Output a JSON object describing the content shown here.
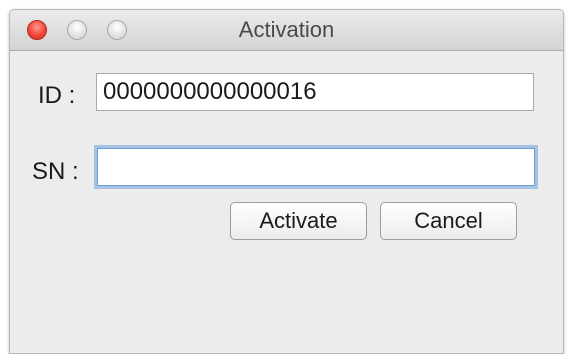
{
  "window": {
    "title": "Activation",
    "controls": {
      "close_icon": "close-traffic-light",
      "minimize_icon": "minimize-traffic-light",
      "zoom_icon": "zoom-traffic-light",
      "close_color": "#f2473a",
      "inactive_color": "#d8d8d8"
    }
  },
  "form": {
    "id_label": "ID :",
    "id_value": "0000000000000016",
    "sn_label": "SN :",
    "sn_value": "",
    "sn_focus_color": "#6c9fd8"
  },
  "buttons": {
    "activate_label": "Activate",
    "cancel_label": "Cancel"
  }
}
